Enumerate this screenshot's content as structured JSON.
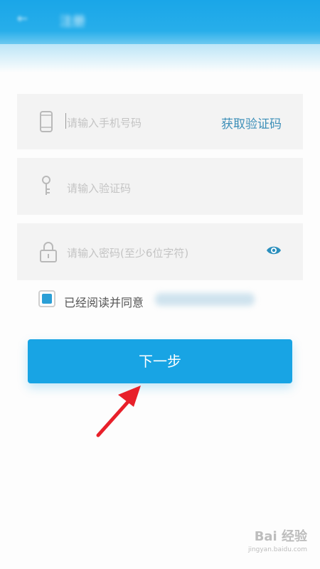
{
  "header": {
    "back_icon": "back-arrow-icon",
    "title": "注册"
  },
  "form": {
    "phone": {
      "icon": "phone-icon",
      "placeholder": "请输入手机号码",
      "value": "",
      "action": "获取验证码"
    },
    "code": {
      "icon": "key-icon",
      "placeholder": "请输入验证码",
      "value": ""
    },
    "password": {
      "icon": "lock-icon",
      "placeholder": "请输入密码(至少6位字符)",
      "value": "",
      "toggle_icon": "eye-icon"
    }
  },
  "agreement": {
    "checked": true,
    "text": "已经阅读并同意"
  },
  "next_button": {
    "label": "下一步"
  },
  "annotation": {
    "icon": "red-arrow-icon"
  },
  "watermark": {
    "brand": "Bai 经验",
    "url": "jingyan.baidu.com"
  },
  "colors": {
    "accent": "#18a4e4",
    "link": "#3d8fb8",
    "arrow": "#e8202a"
  }
}
